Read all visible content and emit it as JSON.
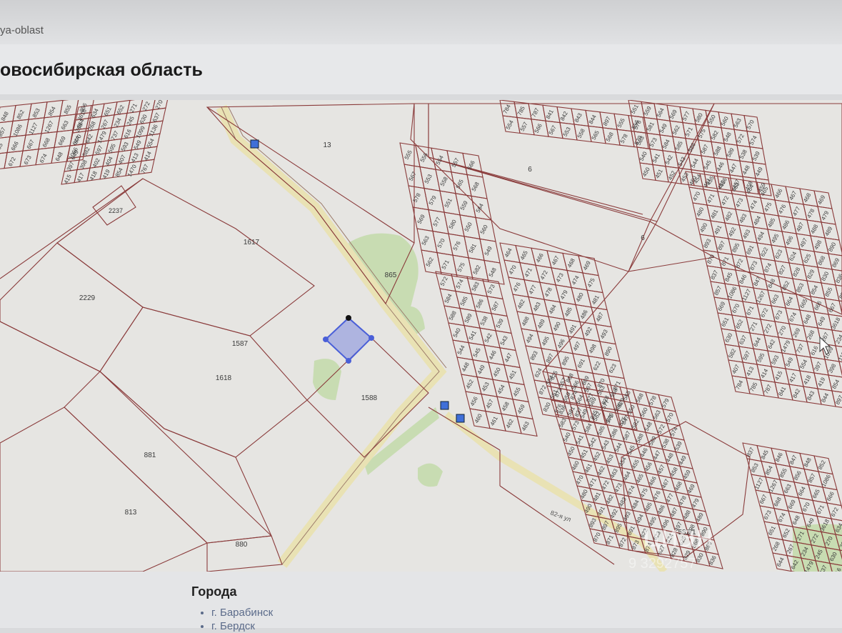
{
  "url_fragment": "ya-oblast",
  "page_title": "овосибирская область",
  "map": {
    "parcels_large": [
      "13",
      "6",
      "6",
      "1617",
      "2229",
      "1587",
      "1618",
      "865",
      "1588",
      "881",
      "813",
      "880",
      "2237",
      "582/1"
    ],
    "parcels_small": [
      "555",
      "556",
      "554",
      "557",
      "566",
      "567",
      "553",
      "558",
      "565",
      "568",
      "578",
      "579",
      "551",
      "559",
      "564",
      "569",
      "577",
      "580",
      "550",
      "560",
      "563",
      "570",
      "576",
      "581",
      "549",
      "562",
      "571",
      "575",
      "582",
      "548",
      "572",
      "574",
      "583",
      "573",
      "584",
      "585",
      "586",
      "587",
      "588",
      "589",
      "538",
      "539",
      "540",
      "541",
      "542",
      "543",
      "544",
      "545",
      "446",
      "447",
      "448",
      "449",
      "450",
      "451",
      "452",
      "453",
      "454",
      "455",
      "456",
      "457",
      "458",
      "459",
      "460",
      "461",
      "462",
      "463",
      "464",
      "465",
      "466",
      "467",
      "468",
      "469",
      "470",
      "471",
      "472",
      "473",
      "474",
      "475",
      "476",
      "477",
      "478",
      "479",
      "480",
      "481",
      "482",
      "483",
      "484",
      "485",
      "486",
      "487",
      "488",
      "489",
      "490",
      "491",
      "492",
      "493",
      "494",
      "495",
      "496",
      "497",
      "498",
      "890",
      "893",
      "897",
      "895",
      "691",
      "622",
      "623",
      "624",
      "625",
      "868",
      "869",
      "870",
      "871",
      "872",
      "873",
      "874",
      "827",
      "828",
      "829",
      "830",
      "836",
      "837",
      "845",
      "846",
      "847",
      "848",
      "852",
      "853",
      "854",
      "855",
      "856",
      "857",
      "1086",
      "1127",
      "1267",
      "663",
      "664",
      "665",
      "666",
      "667",
      "668",
      "669",
      "670",
      "671",
      "672",
      "673",
      "674",
      "648",
      "649",
      "3618",
      "634",
      "651",
      "652",
      "271",
      "272",
      "270",
      "269",
      "268",
      "267",
      "234",
      "245",
      "630",
      "637",
      "644",
      "642",
      "1479",
      "737",
      "616",
      "1099",
      "1136",
      "1066",
      "582",
      "597",
      "595",
      "593",
      "549",
      "554",
      "397",
      "398",
      "402",
      "404",
      "407",
      "413",
      "414",
      "415",
      "417",
      "418",
      "419",
      "854",
      "1470",
      "767",
      "784",
      "785",
      "787",
      "841",
      "842",
      "843",
      "844",
      "897"
    ],
    "road_label": "82-я ул",
    "watermark": "циан",
    "watermark_id": "9 3292757"
  },
  "cities": {
    "heading": "Города",
    "items": [
      "г. Барабинск",
      "г. Бердск"
    ]
  },
  "colors": {
    "boundary": "#8a3b3b",
    "road": "#e9e2b4",
    "green": "#c8dcb2",
    "selection": "#4a5fd8"
  }
}
